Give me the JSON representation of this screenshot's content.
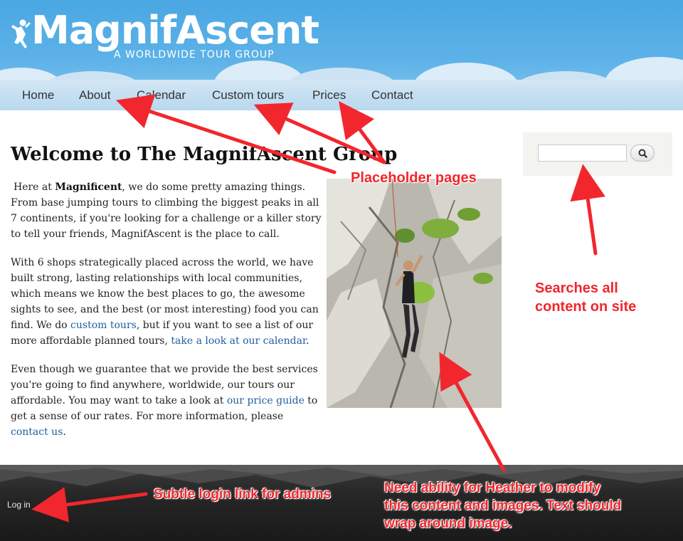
{
  "header": {
    "logo_part1": "Magnif",
    "logo_part2": "Ascent",
    "tagline": "A WORLDWIDE TOUR GROUP"
  },
  "nav": {
    "items": [
      {
        "label": "Home"
      },
      {
        "label": "About"
      },
      {
        "label": "Calendar"
      },
      {
        "label": "Custom tours"
      },
      {
        "label": "Prices"
      },
      {
        "label": "Contact"
      }
    ]
  },
  "main": {
    "title": "Welcome to The MagnifAscent Group",
    "p1": {
      "lead": "Here at ",
      "bold": "Magnificent",
      "rest": ", we do some pretty amazing things. From base jumping tours to climbing the biggest peaks in all 7 continents, if you're looking for a challenge or a killer story to tell your friends, MagnifAscent is the place to call."
    },
    "p2": {
      "text1": "With 6 shops strategically placed across the world, we have built strong, lasting relationships with local communities, which means we know the best places to go, the awesome sights to see, and the best (or most interesting) food you can find. We do ",
      "link1": "custom tours",
      "text2": ", but if you want to see a list of our more affordable planned tours, ",
      "link2": "take a look at our calendar",
      "text3": "."
    },
    "p3": {
      "text1": "Even though we guarantee that we provide the best services you're going to find anywhere, worldwide, our tours our affordable. You may want to take a look at ",
      "link1": "our price guide",
      "text2": " to get a sense of our rates. For more information, please ",
      "link2": "contact us",
      "text3": "."
    }
  },
  "search": {
    "value": "",
    "button_icon": "search-icon"
  },
  "footer": {
    "login_label": "Log in"
  },
  "annotations": {
    "placeholder_pages": "Placeholder pages",
    "searches_line1": "Searches all",
    "searches_line2": "content on site",
    "login_note": "Subtle login link for admins",
    "heather_line1": "Need ability for Heather to modify",
    "heather_line2": "this content and images. Text should",
    "heather_line3": "wrap around image.",
    "color": "#f2262d"
  }
}
